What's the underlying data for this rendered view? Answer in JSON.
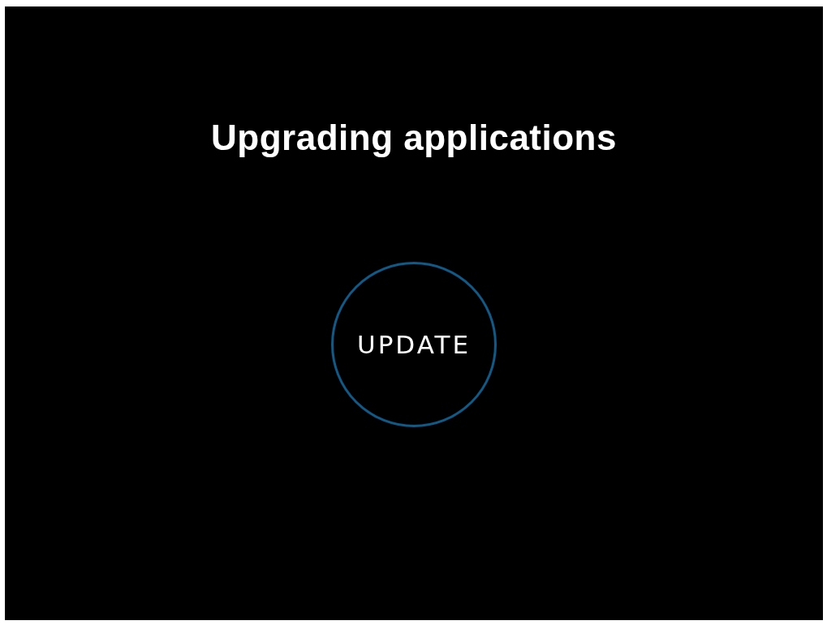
{
  "title": "Upgrading applications",
  "status_ring": {
    "label": "UPDATE"
  }
}
